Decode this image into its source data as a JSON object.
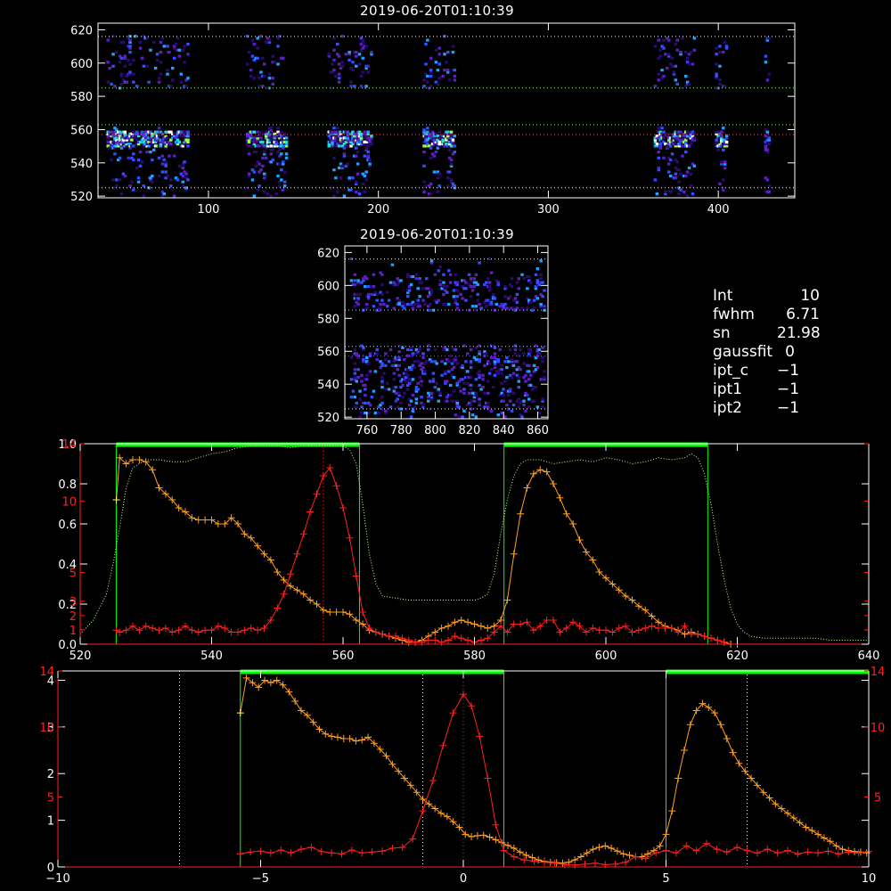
{
  "top_panel": {
    "title": "2019-06-20T01:10:39",
    "x_ticks": [
      "100",
      "200",
      "300",
      "400"
    ],
    "x_values": [
      100,
      200,
      300,
      400
    ],
    "x_range": [
      35,
      445
    ],
    "y_ticks": [
      "520",
      "540",
      "560",
      "580",
      "600",
      "620"
    ],
    "y_values": [
      520,
      540,
      560,
      580,
      600,
      620
    ],
    "y_range": [
      519,
      624
    ]
  },
  "mid_panel": {
    "title": "2019-06-20T01:10:39",
    "x_ticks": [
      "760",
      "780",
      "800",
      "820",
      "840",
      "860"
    ],
    "x_values": [
      760,
      780,
      800,
      820,
      840,
      860
    ],
    "x_range": [
      747,
      866
    ],
    "y_ticks": [
      "520",
      "540",
      "560",
      "580",
      "600",
      "620"
    ],
    "y_values": [
      520,
      540,
      560,
      580,
      600,
      620
    ],
    "y_range": [
      519,
      624
    ]
  },
  "info": [
    {
      "key": "Int",
      "value": "10"
    },
    {
      "key": "fwhm",
      "value": "6.71"
    },
    {
      "key": "sn",
      "value": "21.98"
    },
    {
      "key": "gaussfit",
      "value": "0"
    },
    {
      "key": "ipt_c",
      "value": "−1"
    },
    {
      "key": "ipt1",
      "value": "−1"
    },
    {
      "key": "ipt2",
      "value": "−1"
    }
  ],
  "colors": {
    "bg": "#000000",
    "axis": "#ffffff",
    "axis_red": "#ff2020",
    "orange": "#ffa020",
    "red": "#ff2020",
    "green": "#00ff00",
    "yellow_dot": "#ffff80",
    "dotted_ref": "#c8ff80"
  },
  "chart_data": [
    {
      "type": "line",
      "panel": "filter-profile",
      "xlim": [
        520,
        640
      ],
      "x_ticks": [
        520,
        540,
        560,
        580,
        600,
        620,
        640
      ],
      "x_tick_labels": [
        "520",
        "540",
        "560",
        "580",
        "600",
        "620",
        "640"
      ],
      "ylim": [
        0,
        1.0
      ],
      "y_ticks": [
        0.0,
        0.2,
        0.4,
        0.6,
        0.8,
        1.0
      ],
      "y_tick_labels": [
        "0.0",
        "0.2",
        "0.4",
        "0.6",
        "0.8",
        "1.0"
      ],
      "y2lim": [
        0,
        14
      ],
      "y2_ticks": [
        1,
        2,
        3,
        5,
        10,
        14
      ],
      "y2_tick_labels": [
        "1",
        "2",
        "3",
        "5",
        "10",
        "14"
      ],
      "green_windows": [
        [
          525.5,
          562.5
        ],
        [
          584.5,
          615.5
        ]
      ],
      "vertical_marker": 557,
      "transmission": {
        "x": [
          520,
          522,
          524,
          525,
          526,
          527,
          528,
          530,
          532,
          534,
          536,
          538,
          540,
          542,
          544,
          546,
          548,
          550,
          552,
          554,
          556,
          558,
          560,
          561,
          562,
          563,
          564,
          565,
          566,
          568,
          570,
          572,
          574,
          576,
          578,
          580,
          581,
          582,
          583,
          584,
          585,
          586,
          587,
          588,
          590,
          592,
          594,
          596,
          598,
          600,
          602,
          604,
          606,
          608,
          610,
          612,
          613,
          614,
          615,
          616,
          617,
          618,
          619,
          620,
          621,
          622,
          624,
          626,
          628,
          630,
          632,
          634,
          636,
          638,
          640
        ],
        "values": [
          0.05,
          0.12,
          0.25,
          0.4,
          0.58,
          0.78,
          0.88,
          0.92,
          0.92,
          0.91,
          0.91,
          0.93,
          0.95,
          0.96,
          0.98,
          0.99,
          0.99,
          0.99,
          0.98,
          0.99,
          0.99,
          0.99,
          0.99,
          0.97,
          0.9,
          0.7,
          0.45,
          0.3,
          0.24,
          0.23,
          0.22,
          0.22,
          0.22,
          0.22,
          0.22,
          0.22,
          0.23,
          0.25,
          0.35,
          0.55,
          0.72,
          0.84,
          0.9,
          0.92,
          0.92,
          0.9,
          0.91,
          0.92,
          0.91,
          0.93,
          0.92,
          0.9,
          0.91,
          0.93,
          0.92,
          0.93,
          0.95,
          0.93,
          0.85,
          0.7,
          0.5,
          0.32,
          0.18,
          0.1,
          0.06,
          0.04,
          0.03,
          0.03,
          0.03,
          0.03,
          0.03,
          0.02,
          0.02,
          0.02,
          0.02
        ]
      },
      "series": [
        {
          "color": "orange",
          "x": [
            525.5,
            526,
            527,
            528,
            529,
            530,
            531,
            532,
            533,
            534,
            535,
            536,
            537,
            538,
            539,
            540,
            541,
            542,
            543,
            544,
            545,
            546,
            547,
            548,
            549,
            550,
            551,
            552,
            553,
            554,
            555,
            556,
            557,
            558,
            559,
            560,
            561,
            562,
            563,
            564,
            565,
            566,
            567,
            568,
            569,
            570,
            571,
            572,
            573,
            574,
            575,
            576,
            577,
            578,
            579,
            580,
            581,
            582,
            583,
            584,
            585,
            586,
            587,
            588,
            589,
            590,
            591,
            592,
            593,
            594,
            595,
            596,
            597,
            598,
            599,
            600,
            601,
            602,
            603,
            604,
            605,
            606,
            607,
            608,
            609,
            610,
            611,
            612,
            613,
            614,
            615,
            616,
            617,
            618,
            619,
            620
          ],
          "values": [
            0.72,
            0.93,
            0.9,
            0.92,
            0.92,
            0.91,
            0.87,
            0.78,
            0.75,
            0.72,
            0.68,
            0.66,
            0.63,
            0.62,
            0.62,
            0.62,
            0.6,
            0.6,
            0.63,
            0.6,
            0.55,
            0.53,
            0.49,
            0.45,
            0.42,
            0.36,
            0.32,
            0.29,
            0.27,
            0.25,
            0.22,
            0.2,
            0.17,
            0.16,
            0.16,
            0.16,
            0.15,
            0.12,
            0.1,
            0.07,
            0.06,
            0.05,
            0.04,
            0.03,
            0.02,
            0.01,
            0.01,
            0.02,
            0.04,
            0.06,
            0.08,
            0.09,
            0.11,
            0.12,
            0.11,
            0.1,
            0.09,
            0.08,
            0.09,
            0.12,
            0.22,
            0.45,
            0.65,
            0.78,
            0.85,
            0.87,
            0.86,
            0.8,
            0.73,
            0.65,
            0.6,
            0.52,
            0.46,
            0.42,
            0.36,
            0.33,
            0.3,
            0.27,
            0.24,
            0.22,
            0.19,
            0.17,
            0.14,
            0.11,
            0.09,
            0.08,
            0.07,
            0.05,
            0.06,
            0.05,
            0.04,
            0.03,
            0.02,
            0.01,
            0.0,
            0.0
          ]
        },
        {
          "color": "red",
          "x": [
            525.5,
            526,
            527,
            528,
            529,
            530,
            531,
            532,
            533,
            534,
            535,
            536,
            537,
            538,
            539,
            540,
            541,
            542,
            543,
            544,
            545,
            546,
            547,
            548,
            549,
            550,
            551,
            552,
            553,
            554,
            555,
            556,
            557,
            558,
            559,
            560,
            561,
            562,
            563,
            564,
            565,
            566,
            567,
            568,
            569,
            570,
            571,
            572,
            573,
            574,
            575,
            576,
            577,
            578,
            579,
            580,
            581,
            582,
            583,
            584,
            585,
            586,
            587,
            588,
            589,
            590,
            591,
            592,
            593,
            594,
            595,
            596,
            597,
            598,
            599,
            600,
            601,
            602,
            603,
            604,
            605,
            606,
            607,
            608,
            609,
            610,
            611,
            612,
            613,
            614,
            615,
            616,
            617,
            618
          ],
          "values": [
            0.07,
            0.06,
            0.07,
            0.09,
            0.07,
            0.09,
            0.08,
            0.07,
            0.08,
            0.06,
            0.07,
            0.09,
            0.07,
            0.06,
            0.07,
            0.07,
            0.09,
            0.08,
            0.06,
            0.06,
            0.07,
            0.08,
            0.07,
            0.08,
            0.12,
            0.18,
            0.25,
            0.35,
            0.45,
            0.55,
            0.66,
            0.75,
            0.84,
            0.88,
            0.79,
            0.68,
            0.53,
            0.34,
            0.16,
            0.08,
            0.06,
            0.05,
            0.04,
            0.04,
            0.03,
            0.02,
            0.01,
            0.01,
            0.02,
            0.02,
            0.01,
            0.02,
            0.04,
            0.03,
            0.02,
            0.01,
            0.02,
            0.03,
            0.06,
            0.09,
            0.06,
            0.1,
            0.1,
            0.11,
            0.07,
            0.09,
            0.12,
            0.12,
            0.06,
            0.08,
            0.11,
            0.09,
            0.06,
            0.08,
            0.07,
            0.07,
            0.06,
            0.08,
            0.09,
            0.06,
            0.07,
            0.08,
            0.09,
            0.08,
            0.08,
            0.08,
            0.06,
            0.09,
            0.05,
            0.05,
            0.04,
            0.03,
            0.02,
            0.01
          ]
        }
      ]
    },
    {
      "type": "line",
      "panel": "offset-profile",
      "xlim": [
        -10,
        10
      ],
      "x_ticks": [
        -10,
        -5,
        0,
        5,
        10
      ],
      "x_tick_labels": [
        "−10",
        "−5",
        "0",
        "5",
        "10"
      ],
      "ylim": [
        0,
        4.2
      ],
      "y_ticks": [
        0,
        1,
        2,
        3,
        4
      ],
      "y_tick_labels": [
        "0",
        "1",
        "2",
        "3",
        "4"
      ],
      "y2lim": [
        0,
        14
      ],
      "y2_ticks": [
        5,
        10,
        14
      ],
      "y2_tick_labels": [
        "5",
        "10",
        "14"
      ],
      "green_windows": [
        [
          -5.5,
          1.0
        ],
        [
          5.0,
          10.0
        ]
      ],
      "dotted_lines": [
        -7,
        -1,
        7
      ],
      "red_dotted_line": 0,
      "series": [
        {
          "color": "orange",
          "x": [
            -5.5,
            -5.35,
            -5.2,
            -5.05,
            -4.9,
            -4.75,
            -4.6,
            -4.45,
            -4.3,
            -4.15,
            -4.0,
            -3.85,
            -3.7,
            -3.55,
            -3.4,
            -3.25,
            -3.1,
            -2.95,
            -2.8,
            -2.65,
            -2.5,
            -2.35,
            -2.2,
            -2.05,
            -1.9,
            -1.75,
            -1.6,
            -1.45,
            -1.3,
            -1.15,
            -1.0,
            -0.85,
            -0.7,
            -0.55,
            -0.4,
            -0.25,
            -0.1,
            0.05,
            0.2,
            0.35,
            0.5,
            0.65,
            0.8,
            0.95,
            1.1,
            1.25,
            1.4,
            1.55,
            1.7,
            1.85,
            2.0,
            2.15,
            2.3,
            2.45,
            2.6,
            2.75,
            2.9,
            3.05,
            3.2,
            3.35,
            3.5,
            3.65,
            3.8,
            3.95,
            4.1,
            4.25,
            4.4,
            4.55,
            4.7,
            4.85,
            5.0,
            5.15,
            5.3,
            5.45,
            5.6,
            5.75,
            5.9,
            6.05,
            6.2,
            6.35,
            6.5,
            6.65,
            6.8,
            6.95,
            7.1,
            7.25,
            7.4,
            7.55,
            7.7,
            7.85,
            8.0,
            8.15,
            8.3,
            8.45,
            8.6,
            8.75,
            8.9,
            9.05,
            9.2,
            9.35,
            9.5,
            9.65,
            9.8,
            9.95
          ],
          "values": [
            3.3,
            4.05,
            3.95,
            3.85,
            4.0,
            3.95,
            4.0,
            3.9,
            3.75,
            3.55,
            3.35,
            3.25,
            3.1,
            2.95,
            2.85,
            2.8,
            2.78,
            2.75,
            2.75,
            2.7,
            2.72,
            2.78,
            2.65,
            2.52,
            2.38,
            2.2,
            2.05,
            1.9,
            1.75,
            1.6,
            1.45,
            1.35,
            1.25,
            1.15,
            1.08,
            0.97,
            0.85,
            0.7,
            0.65,
            0.67,
            0.68,
            0.64,
            0.58,
            0.52,
            0.46,
            0.4,
            0.32,
            0.25,
            0.2,
            0.15,
            0.12,
            0.1,
            0.09,
            0.08,
            0.1,
            0.15,
            0.22,
            0.3,
            0.38,
            0.42,
            0.45,
            0.4,
            0.34,
            0.28,
            0.25,
            0.22,
            0.22,
            0.28,
            0.35,
            0.45,
            0.7,
            1.2,
            1.9,
            2.5,
            3.05,
            3.35,
            3.5,
            3.42,
            3.3,
            3.05,
            2.75,
            2.45,
            2.22,
            2.05,
            1.9,
            1.75,
            1.6,
            1.48,
            1.35,
            1.25,
            1.15,
            1.05,
            0.95,
            0.85,
            0.78,
            0.7,
            0.62,
            0.55,
            0.45,
            0.38,
            0.35,
            0.33,
            0.32,
            0.3
          ]
        },
        {
          "color": "red",
          "x": [
            -5.5,
            -5.25,
            -5.0,
            -4.75,
            -4.5,
            -4.25,
            -4.0,
            -3.75,
            -3.5,
            -3.25,
            -3.0,
            -2.75,
            -2.5,
            -2.25,
            -2.0,
            -1.75,
            -1.5,
            -1.25,
            -1.0,
            -0.75,
            -0.5,
            -0.25,
            0.0,
            0.2,
            0.4,
            0.6,
            0.8,
            1.0,
            1.25,
            1.5,
            1.75,
            2.0,
            2.25,
            2.5,
            2.75,
            3.0,
            3.25,
            3.5,
            3.75,
            4.0,
            4.25,
            4.5,
            4.75,
            5.0,
            5.25,
            5.5,
            5.75,
            6.0,
            6.25,
            6.5,
            6.75,
            7.0,
            7.25,
            7.5,
            7.75,
            8.0,
            8.25,
            8.5,
            8.75,
            9.0,
            9.25,
            9.5,
            9.75,
            10.0
          ],
          "values": [
            0.28,
            0.32,
            0.34,
            0.3,
            0.36,
            0.3,
            0.38,
            0.42,
            0.33,
            0.3,
            0.28,
            0.36,
            0.3,
            0.32,
            0.34,
            0.4,
            0.42,
            0.6,
            1.2,
            1.85,
            2.6,
            3.3,
            3.7,
            3.45,
            2.8,
            1.9,
            0.9,
            0.35,
            0.22,
            0.15,
            0.12,
            0.1,
            0.08,
            0.05,
            0.04,
            0.06,
            0.08,
            0.05,
            0.06,
            0.1,
            0.22,
            0.18,
            0.3,
            0.35,
            0.3,
            0.45,
            0.35,
            0.5,
            0.38,
            0.32,
            0.42,
            0.35,
            0.3,
            0.38,
            0.3,
            0.35,
            0.28,
            0.32,
            0.3,
            0.34,
            0.28,
            0.32,
            0.3,
            0.33
          ]
        }
      ]
    }
  ]
}
